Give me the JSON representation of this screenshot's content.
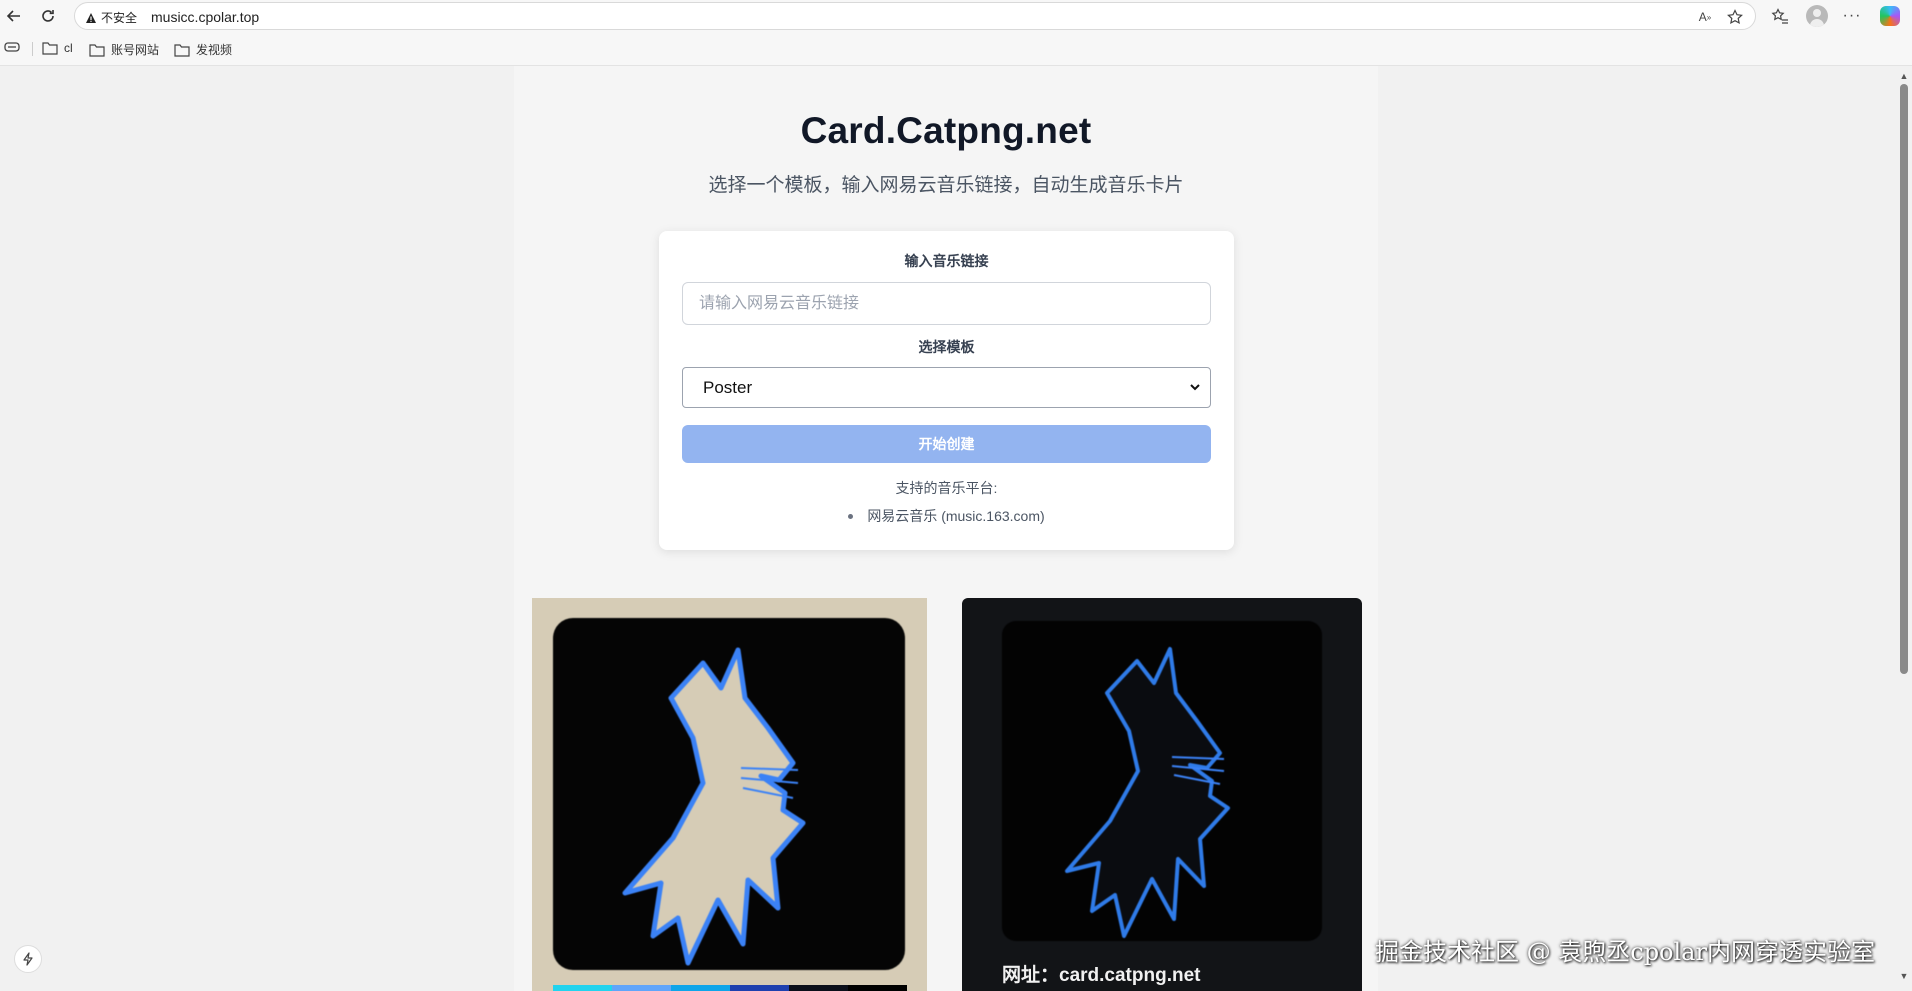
{
  "browser": {
    "security_label": "不安全",
    "url": "musicc.cpolar.top"
  },
  "bookmarks": [
    {
      "label": "cl"
    },
    {
      "label": "账号网站"
    },
    {
      "label": "发视频"
    }
  ],
  "page": {
    "title": "Card.Catpng.net",
    "subtitle": "选择一个模板，输入网易云音乐链接，自动生成音乐卡片"
  },
  "form": {
    "link_label": "输入音乐链接",
    "link_placeholder": "请输入网易云音乐链接",
    "link_value": "",
    "template_label": "选择模板",
    "template_selected": "Poster",
    "create_button": "开始创建",
    "platforms_title": "支持的音乐平台:",
    "platforms": [
      "网易云音乐 (music.163.com)"
    ]
  },
  "previews": {
    "card2_url_text": "网址：card.catpng.net",
    "swatch_colors": [
      "#22d3ee",
      "#60a5fa",
      "#0ea5e9",
      "#1e40af",
      "#0b0f1a",
      "#000000"
    ]
  },
  "colors": {
    "primary_button": "#93b4f0",
    "card1_bg": "#d6ccb6",
    "card2_bg": "#121417",
    "cat_outline": "#3b82f6"
  },
  "watermark": "掘金技术社区 @ 袁煦丞cpolar内网穿透实验室"
}
